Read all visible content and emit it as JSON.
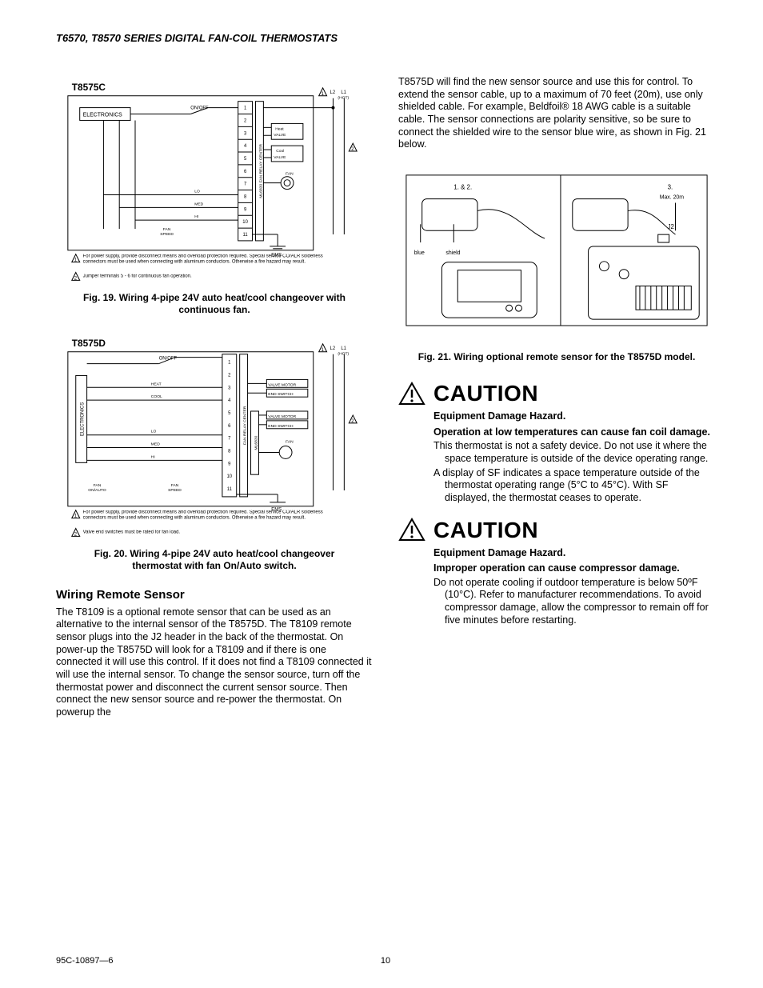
{
  "running_head": "T6570, T8570 SERIES DIGITAL FAN-COIL THERMOSTATS",
  "footer_left": "95C-10897—6",
  "footer_page": "10",
  "left_col": {
    "fig19": {
      "model": "T8575C",
      "box_left": "ELECTRONICS",
      "switch": "ON/OFF",
      "right_strip": "ML6830 FAN RELAY CENTER",
      "box_r1": "Heat VALVE",
      "box_r2": "Cool VALVE",
      "fan_label": "FAN",
      "lo": "LO",
      "med": "MED",
      "hi": "HI",
      "fan_speed": "FAN SPEED",
      "ems": "EMS",
      "l2": "L2",
      "l1": "L1",
      "hot": "(HOT)",
      "terms": [
        "1",
        "2",
        "3",
        "4",
        "5",
        "6",
        "7",
        "8",
        "9",
        "10",
        "11"
      ],
      "note1_tri": "1",
      "note2_tri": "2",
      "note1": "For power supply, provide disconnect means and overload protection required. Special service CO/ALR solderless connectors must be used when connecting with aluminum conductors. Otherwise a fire hazard may result.",
      "note2": "Jumper terminals 5 - 6 for continuous fan operation."
    },
    "fig19_cap": "Fig. 19. Wiring 4-pipe 24V auto heat/cool changeover with continuous fan.",
    "fig20": {
      "model": "T8575D",
      "box_left": "ELECTRONICS",
      "switch": "ON/OFF",
      "heat": "HEAT",
      "cool": "COOL",
      "right_strip1": "FAN RELAY CENTER",
      "right_strip2": "ML6830",
      "vm": "VALVE MOTOR",
      "es": "END SWITCH",
      "fan_label": "FAN",
      "lo": "LO",
      "med": "MED",
      "hi": "HI",
      "fan_speed": "FAN SPEED",
      "fan_onauto": "FAN ON/AUTO",
      "ems": "EMS",
      "l2": "L2",
      "l1": "L1",
      "hot": "(HOT)",
      "terms": [
        "1",
        "2",
        "3",
        "4",
        "5",
        "6",
        "7",
        "8",
        "9",
        "10",
        "11"
      ],
      "note1_tri": "1",
      "note2_tri": "2",
      "note1": "For power supply, provide disconnect means and overload protection required. Special service CO/ALR solderless connectors must be used when connecting with aluminum conductors. Otherwise a fire hazard may result.",
      "note2": "Valve end switches must be rated for fan load."
    },
    "fig20_cap": "Fig. 20. Wiring 4-pipe 24V auto heat/cool changeover thermostat with fan On/Auto switch.",
    "sub_head": "Wiring Remote Sensor",
    "para": "The T8109 is a optional remote sensor that can be used as an alternative to the internal sensor of the T8575D. The T8109 remote sensor plugs into the J2 header in the back of the thermostat. On power-up the T8575D will look for a T8109 and if there is one connected it will use this control. If it does not find a T8109 connected it will use the internal sensor. To change the sensor source, turn off the thermostat power and disconnect the current sensor source. Then connect the new sensor source and re-power the thermostat. On powerup the"
  },
  "right_col": {
    "top_para": "T8575D will find the new sensor source and use this for control. To extend the sensor cable, up to a maximum of 70 feet (20m), use only shielded cable. For example, Beldfoil® 18 AWG cable is a suitable cable. The sensor connections are polarity sensitive, so be sure to connect the shielded wire to the sensor blue wire, as shown in Fig. 21 below.",
    "fig21": {
      "step12": "1.  &  2.",
      "step3": "3.",
      "maxlen": "Max. 20m",
      "j2": "J2",
      "blue": "blue",
      "shield": "shield"
    },
    "fig21_cap": "Fig. 21. Wiring optional remote sensor for the T8575D model.",
    "caution1": {
      "word": "CAUTION",
      "sub1": "Equipment Damage Hazard.",
      "sub2": "Operation at low temperatures can cause fan coil damage.",
      "body1": "This thermostat is not a safety device. Do not use it where the space temperature is outside of the device operating range.",
      "body2": "A display of SF indicates a space temperature outside of the thermostat operating range (5°C to 45°C). With SF displayed, the thermostat ceases to operate."
    },
    "caution2": {
      "word": "CAUTION",
      "sub1": "Equipment Damage Hazard.",
      "sub2": "Improper operation can cause compressor damage.",
      "body1": "Do not operate cooling if outdoor temperature is below 50ºF (10°C). Refer to manufacturer recommendations. To avoid compressor damage, allow the compressor to remain off for five minutes before restarting."
    }
  }
}
